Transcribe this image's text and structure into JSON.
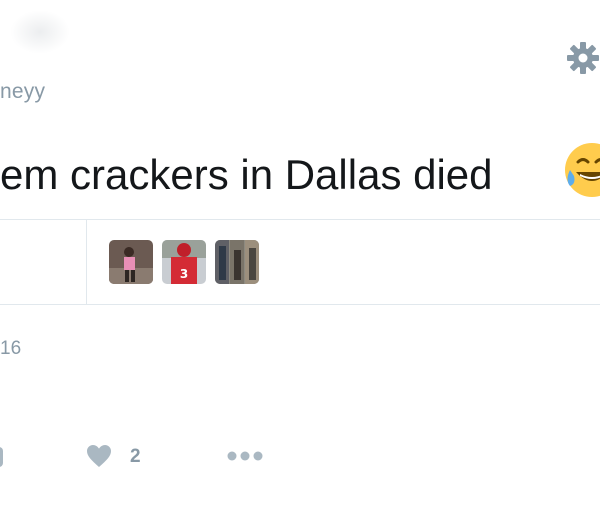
{
  "tweet": {
    "handle": "neyy",
    "text": "em crackers in Dallas died",
    "emoji_icon": "face-with-tears-of-joy-icon",
    "date": "16"
  },
  "actions": {
    "like_count": "2"
  },
  "likers": [
    {
      "name": "liker-avatar-1"
    },
    {
      "name": "liker-avatar-2"
    },
    {
      "name": "liker-avatar-3"
    }
  ],
  "colors": {
    "text": "#14171a",
    "muted": "#8899a6",
    "icon": "#aab8c2",
    "divider": "#e1e8ed"
  }
}
